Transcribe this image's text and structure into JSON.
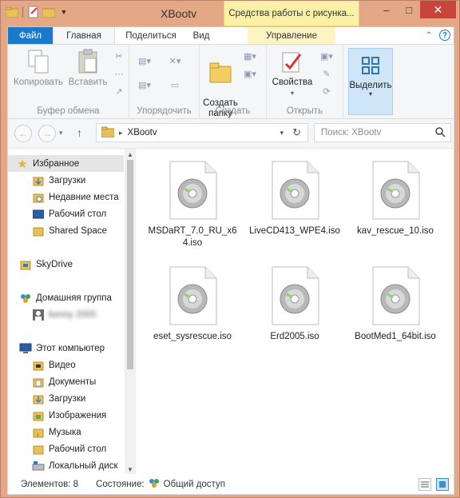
{
  "window": {
    "title": "XBootv",
    "context_title": "Средства работы с рисунка...",
    "controls": {
      "minimize": "–",
      "maximize": "□",
      "close": "✕"
    }
  },
  "tabs": {
    "file": "Файл",
    "home": "Главная",
    "share": "Поделиться",
    "view": "Вид",
    "manage": "Управление"
  },
  "ribbon": {
    "clipboard": {
      "label": "Буфер обмена",
      "copy": "Копировать",
      "paste": "Вставить"
    },
    "organize": {
      "label": "Упорядочить"
    },
    "create": {
      "label": "Создать",
      "new_folder": "Создать\nпапку"
    },
    "open": {
      "label": "Открыть",
      "properties": "Свойства"
    },
    "select": {
      "label": "Выделить"
    }
  },
  "address": {
    "path_folder": "XBootv",
    "search_placeholder": "Поиск: XBootv"
  },
  "navpane": {
    "items": [
      {
        "label": "Избранное",
        "icon": "star-icon"
      },
      {
        "label": "Загрузки",
        "icon": "downloads-folder-icon"
      },
      {
        "label": "Недавние места",
        "icon": "recent-places-icon"
      },
      {
        "label": "Рабочий стол",
        "icon": "desktop-icon"
      },
      {
        "label": "Shared Space",
        "icon": "folder-icon"
      },
      {
        "label": "SkyDrive",
        "icon": "skydrive-icon"
      },
      {
        "label": "Домашняя группа",
        "icon": "homegroup-icon"
      },
      {
        "label": "kenny 2000",
        "icon": "user-icon"
      },
      {
        "label": "Этот компьютер",
        "icon": "computer-icon"
      },
      {
        "label": "Видео",
        "icon": "videos-folder-icon"
      },
      {
        "label": "Документы",
        "icon": "documents-folder-icon"
      },
      {
        "label": "Загрузки",
        "icon": "downloads-folder-icon"
      },
      {
        "label": "Изображения",
        "icon": "pictures-folder-icon"
      },
      {
        "label": "Музыка",
        "icon": "music-folder-icon"
      },
      {
        "label": "Рабочий стол",
        "icon": "desktop-folder-icon"
      },
      {
        "label": "Локальный диск",
        "icon": "local-disk-icon"
      }
    ]
  },
  "files": [
    {
      "name": "MSDaRT_7.0_RU_x64.iso"
    },
    {
      "name": "LiveCD413_WPE4.iso"
    },
    {
      "name": "kav_rescue_10.iso"
    },
    {
      "name": "eset_sysrescue.iso"
    },
    {
      "name": "Erd2005.iso"
    },
    {
      "name": "BootMed1_64bit.iso"
    }
  ],
  "status": {
    "items_label": "Элементов: 8",
    "state_label": "Состояние:",
    "state_value": "Общий доступ"
  },
  "colors": {
    "frame": "#e4a887",
    "file_tab": "#1979ca",
    "context_tab": "#fbf0a8",
    "close": "#c7453a"
  }
}
